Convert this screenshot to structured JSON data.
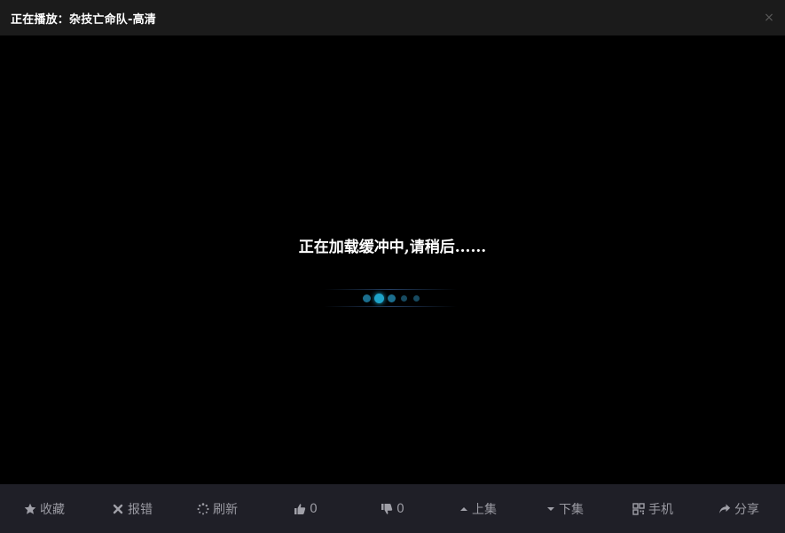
{
  "window": {
    "title": "正在播放：杂技亡命队-高清",
    "close_glyph": "×"
  },
  "player": {
    "loading_text": "正在加载缓冲中,请稍后......",
    "loader": {
      "dot_colors": [
        "#1b6e8e",
        "#1ea3c8",
        "#1b6e8e",
        "#174a60",
        "#174a60"
      ]
    }
  },
  "toolbar": {
    "favorite_label": "收藏",
    "report_label": "报错",
    "refresh_label": "刷新",
    "like_count": "0",
    "dislike_count": "0",
    "prev_label": "上集",
    "next_label": "下集",
    "mobile_label": "手机",
    "share_label": "分享"
  },
  "icons": {
    "favorite": "star-icon",
    "report": "x-icon",
    "refresh": "spinner-icon",
    "like": "thumbs-up-icon",
    "dislike": "thumbs-down-icon",
    "prev": "caret-up-icon",
    "next": "caret-down-icon",
    "mobile": "qr-code-icon",
    "share": "share-arrow-icon"
  },
  "colors": {
    "titlebar_bg": "#1b1b1b",
    "toolbar_bg": "#1f1f27",
    "toolbar_text": "#9a9aa2",
    "accent_dot": "#1ea3c8"
  }
}
